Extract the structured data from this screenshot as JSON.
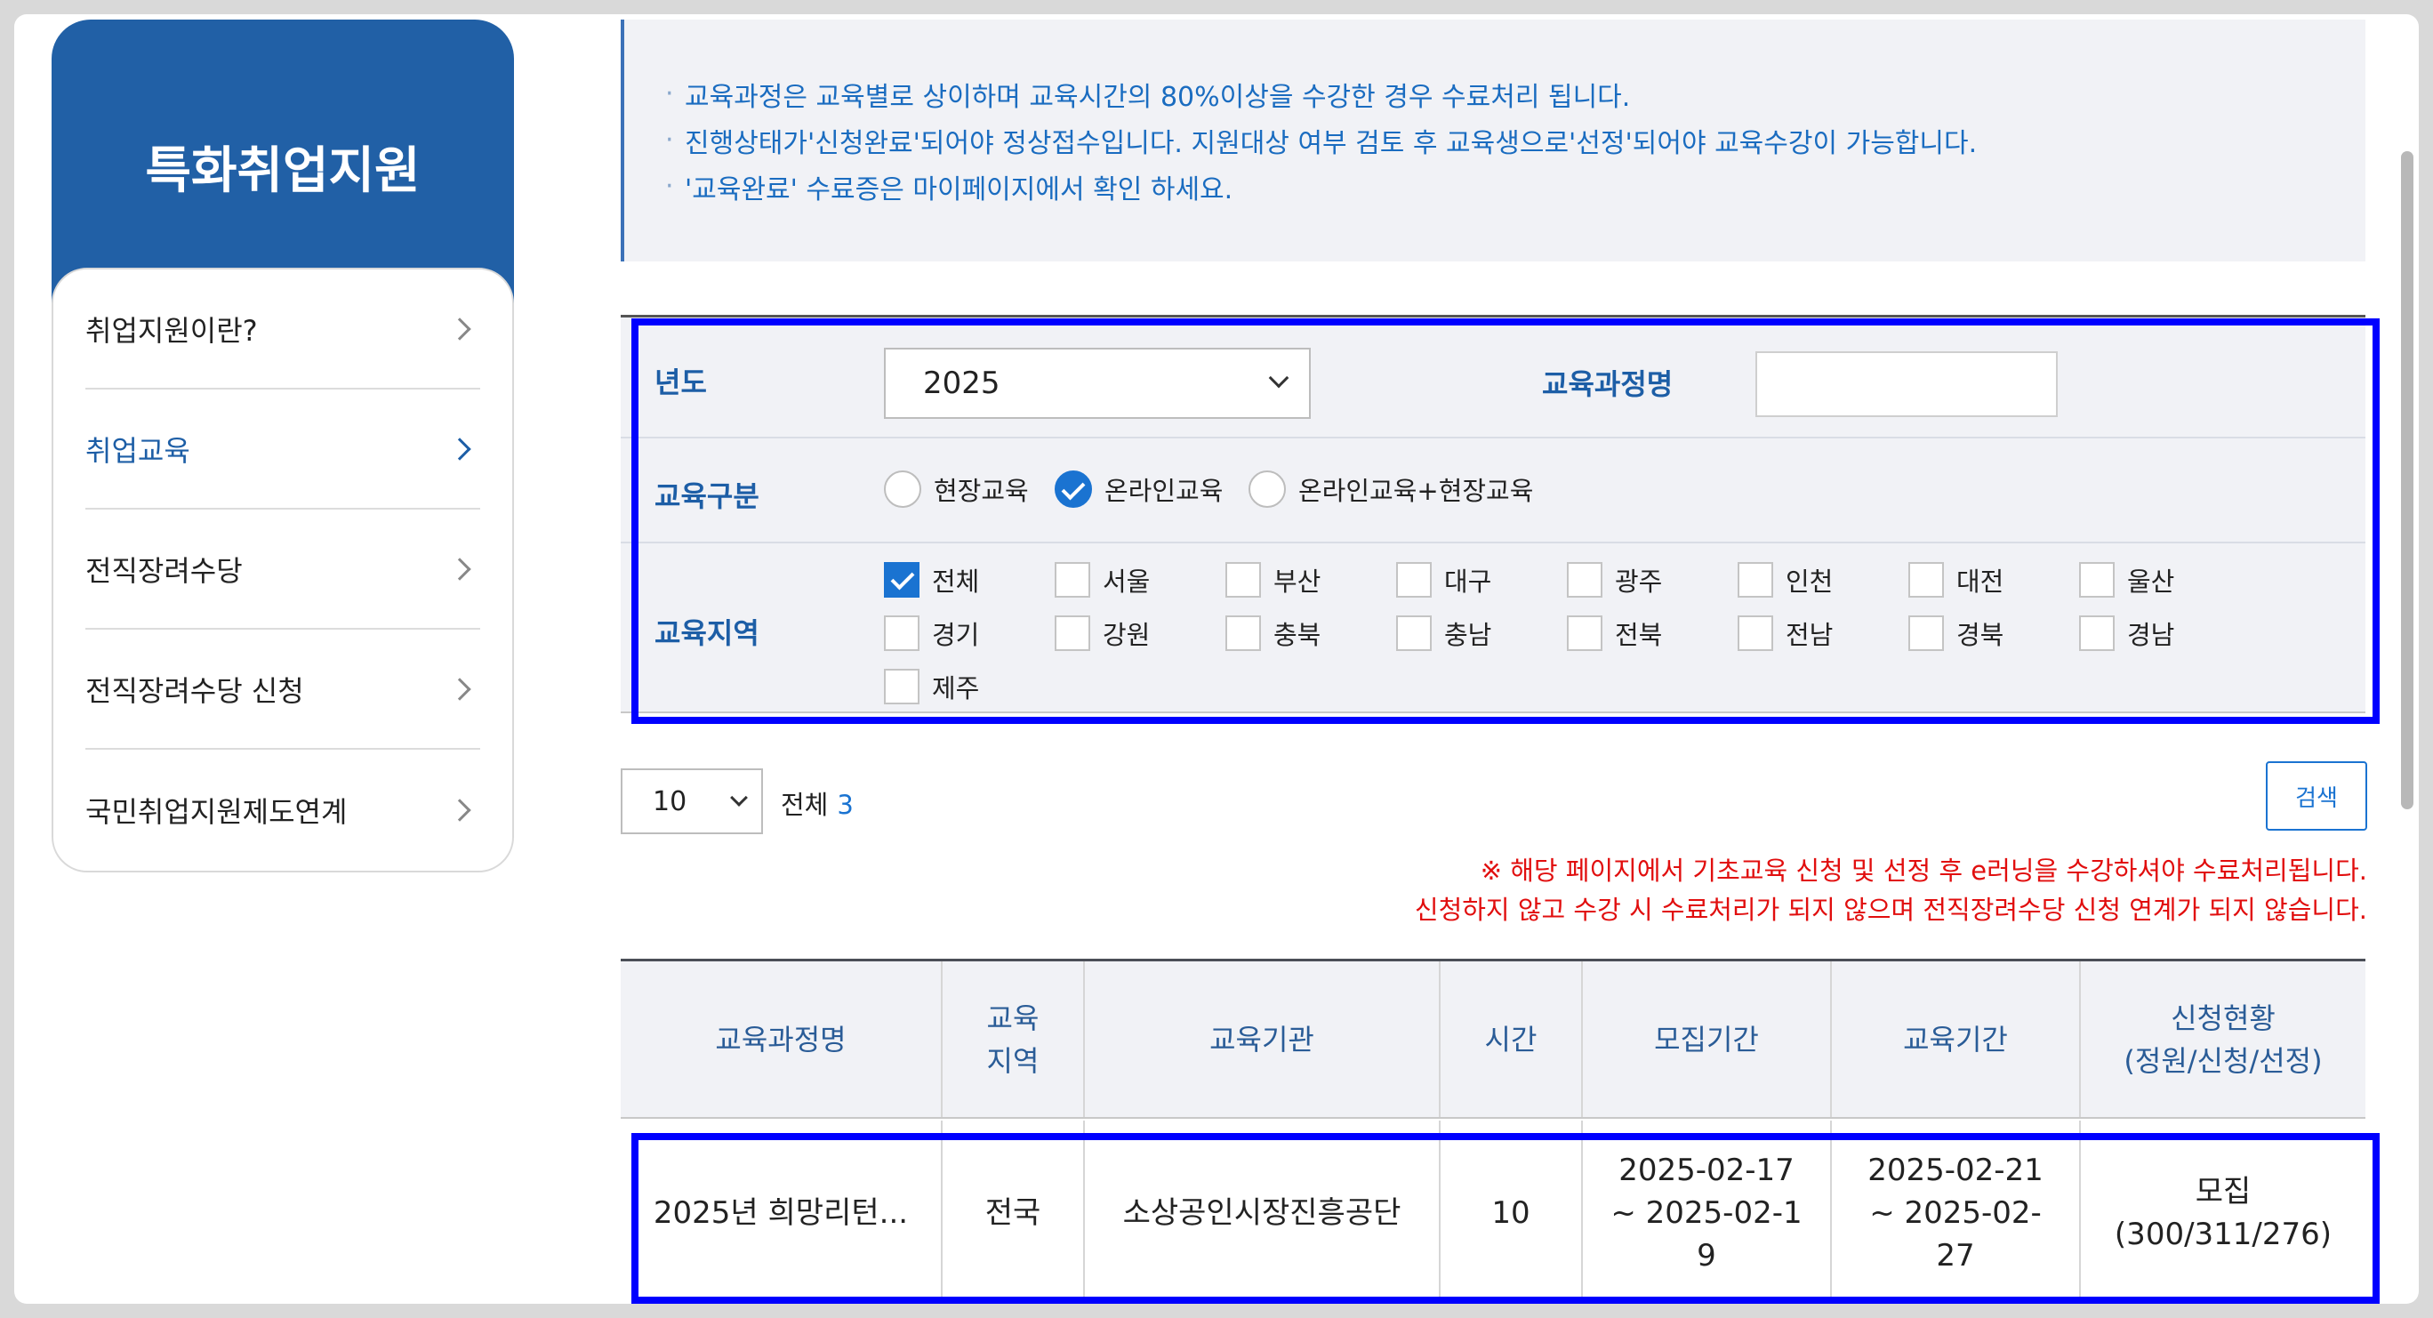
{
  "sidebar": {
    "title": "특화취업지원",
    "items": [
      {
        "label": "취업지원이란?"
      },
      {
        "label": "취업교육"
      },
      {
        "label": "전직장려수당"
      },
      {
        "label": "전직장려수당 신청"
      },
      {
        "label": "국민취업지원제도연계"
      }
    ]
  },
  "notice": {
    "lines": [
      "교육과정은 교육별로 상이하며 교육시간의 80%이상을 수강한 경우 수료처리 됩니다.",
      "진행상태가'신청완료'되어야 정상접수입니다. 지원대상 여부 검토 후 교육생으로'선정'되어야 교육수강이 가능합니다.",
      "'교육완료' 수료증은 마이페이지에서 확인 하세요."
    ]
  },
  "filter": {
    "year_label": "년도",
    "year_value": "2025",
    "course_label": "교육과정명",
    "course_value": "",
    "type_label": "교육구분",
    "types": [
      {
        "label": "현장교육",
        "checked": false
      },
      {
        "label": "온라인교육",
        "checked": true
      },
      {
        "label": "온라인교육+현장교육",
        "checked": false
      }
    ],
    "region_label": "교육지역",
    "regions": [
      {
        "label": "전체",
        "checked": true
      },
      {
        "label": "서울",
        "checked": false
      },
      {
        "label": "부산",
        "checked": false
      },
      {
        "label": "대구",
        "checked": false
      },
      {
        "label": "광주",
        "checked": false
      },
      {
        "label": "인천",
        "checked": false
      },
      {
        "label": "대전",
        "checked": false
      },
      {
        "label": "울산",
        "checked": false
      },
      {
        "label": "경기",
        "checked": false
      },
      {
        "label": "강원",
        "checked": false
      },
      {
        "label": "충북",
        "checked": false
      },
      {
        "label": "충남",
        "checked": false
      },
      {
        "label": "전북",
        "checked": false
      },
      {
        "label": "전남",
        "checked": false
      },
      {
        "label": "경북",
        "checked": false
      },
      {
        "label": "경남",
        "checked": false
      },
      {
        "label": "제주",
        "checked": false
      }
    ]
  },
  "controls": {
    "page_size": "10",
    "total_label": "전체",
    "total_count": "3",
    "search_label": "검색",
    "warning_1": "※ 해당 페이지에서 기초교육 신청 및 선정 후 e러닝을 수강하셔야 수료처리됩니다.",
    "warning_2": "신청하지 않고 수강 시 수료처리가 되지 않으며 전직장려수당 신청 연계가 되지 않습니다."
  },
  "table": {
    "headers": [
      "교육과정명",
      "교육\n지역",
      "교육기관",
      "시간",
      "모집기간",
      "교육기간",
      "신청현황\n(정원/신청/선정)"
    ],
    "rows": [
      {
        "course": "2025년 희망리턴...",
        "region": "전국",
        "institution": "소상공인시장진흥공단",
        "hours": "10",
        "recruit_period": "2025-02-17\n~ 2025-02-1\n9",
        "edu_period": "2025-02-21\n~ 2025-02-\n27",
        "status": "모집\n(300/311/276)"
      }
    ]
  }
}
